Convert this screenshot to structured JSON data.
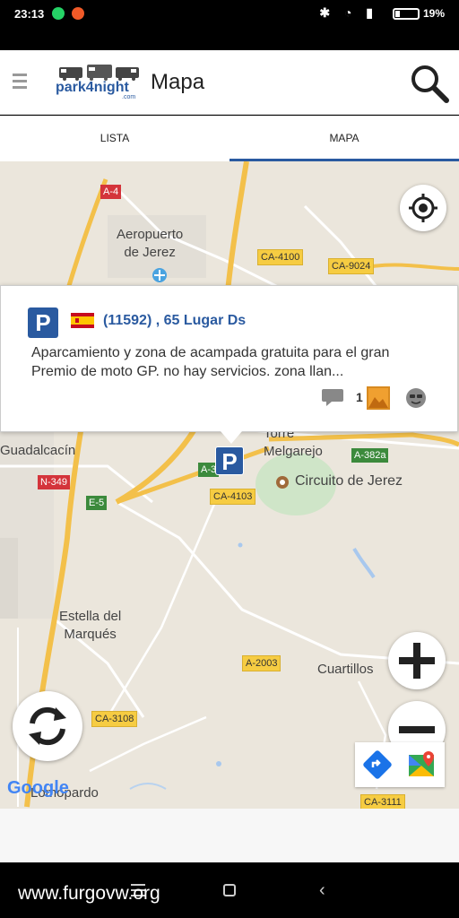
{
  "status_bar": {
    "time": "23:13",
    "battery": "19%"
  },
  "header": {
    "logo_text": "park4night",
    "logo_sub": ".com",
    "title": "Mapa"
  },
  "tabs": [
    {
      "label": "LISTA",
      "selected": false
    },
    {
      "label": "MAPA",
      "selected": true
    }
  ],
  "map": {
    "places": {
      "airport": "Aeropuerto\nde Jerez",
      "guadalcacin": "Guadalcacín",
      "torre": "Torre\nMelgarejo",
      "circuito": "Circuito de Jerez",
      "estella": "Estella del\nMarqués",
      "cuartillos": "Cuartillos",
      "lomopardo": "Lomopardo"
    },
    "roads": {
      "a4": "A-4",
      "ca4100": "CA-4100",
      "ca9024": "CA-9024",
      "a382a": "A-382a",
      "n349": "N-349",
      "e5": "E-5",
      "a3": "A-3",
      "ca4103": "CA-4103",
      "a2003": "A-2003",
      "ca3108": "CA-3108",
      "ca3111": "CA-3111"
    },
    "google": "Google",
    "colors": {
      "land": "#ebe6dc",
      "highway": "#f6cc42",
      "accent": "#2a5aa0"
    }
  },
  "popup": {
    "marker": "P",
    "title": "(11592) , 65 Lugar Ds",
    "description": "Aparcamiento y zona de acampada gratuita para el gran Premio de moto GP. no hay servicios. zona llan...",
    "photo_count": "1"
  },
  "watermark": "www.furgovw.org"
}
